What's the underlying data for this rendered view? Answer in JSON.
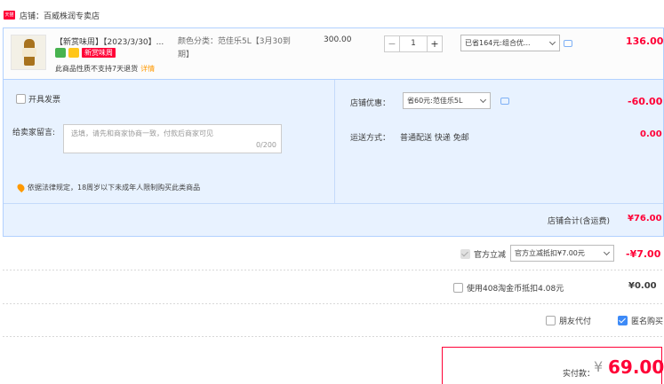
{
  "shop": {
    "badge": "天猫",
    "label": "店铺：百威株润专卖店"
  },
  "item": {
    "title": "【新赏味周】【2023/3/30】...",
    "promo_tag": "新赏味周",
    "no_return_text": "此商品性质不支持7天退货",
    "detail_link": "详情",
    "sku": "颜色分类：范佳乐5L【3月30到期】",
    "unit_price": "300.00",
    "quantity": "1",
    "discount_select": "已省164元:组合优...",
    "total": "136.00"
  },
  "order_options": {
    "invoice_label": "开具发票",
    "memo_label": "给卖家留言:",
    "memo_placeholder": "选填，请先和商家协商一致，付款后商家可见",
    "memo_count": "0/200",
    "law_notice": "依据法律规定，18周岁以下未成年人限制购买此类商品",
    "shop_discount_label": "店铺优惠：",
    "shop_discount_select": "省60元:范佳乐5L",
    "shop_discount_value": "-60.00",
    "shipping_label": "运送方式：",
    "shipping_text": "普通配送 快递 免邮",
    "shipping_value": "0.00",
    "subtotal_label": "店铺合计(含运费)",
    "subtotal_value": "¥76.00"
  },
  "official_discount": {
    "label": "官方立减",
    "select": "官方立减抵扣¥7.00元",
    "value": "-¥7.00"
  },
  "coins": {
    "label": "使用408淘金币抵扣4.08元",
    "value": "¥0.00"
  },
  "friend_pay": {
    "label": "朋友代付"
  },
  "anonymous": {
    "label": "匿名购买"
  },
  "payment": {
    "label": "实付款：",
    "symbol": "¥",
    "amount": "69.00"
  }
}
